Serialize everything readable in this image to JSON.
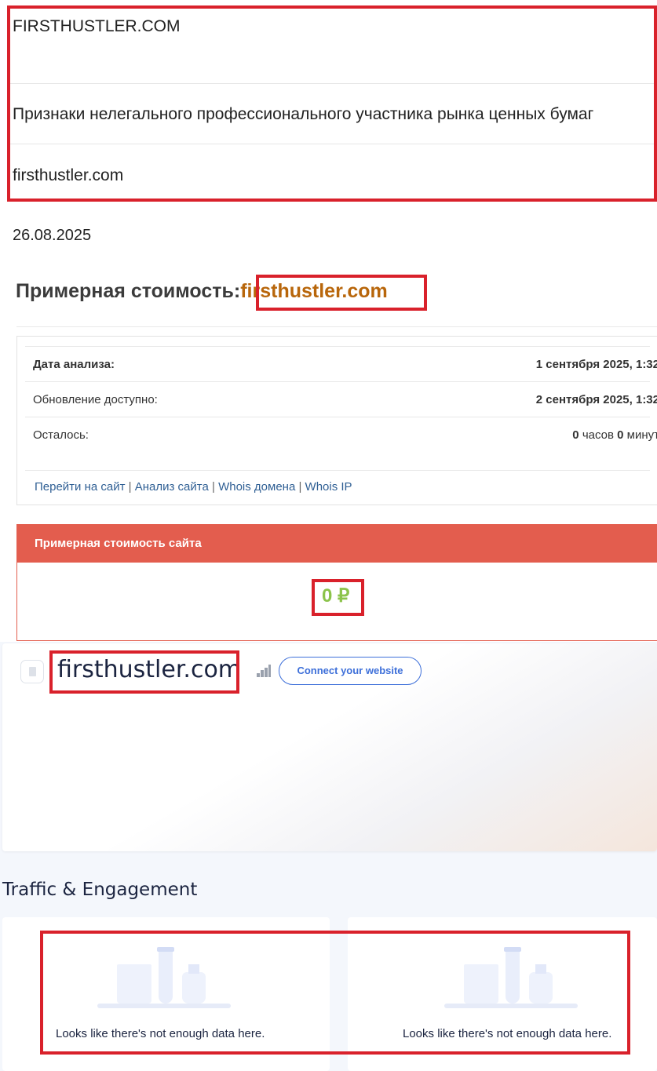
{
  "top_table": {
    "title": "FIRSTHUSTLER.COM",
    "description": "Признаки нелегального профессионального участника рынка ценных бумаг",
    "url": "firsthustler.com"
  },
  "date": "26.08.2025",
  "cost_heading": {
    "label": "Примерная стоимость:",
    "domain": "firsthustler.com"
  },
  "analysis": {
    "rows": [
      {
        "label": "Дата анализа:",
        "value": "1 сентября 2025, 1:32"
      },
      {
        "label": "Обновление доступно:",
        "value": "2 сентября 2025, 1:32"
      },
      {
        "label": "Осталось:",
        "hours": "0",
        "hours_unit": "часов",
        "minutes": "0",
        "minutes_unit": "минут"
      }
    ],
    "links": [
      "Перейти на сайт",
      "Анализ сайта",
      "Whois домена",
      "Whois IP"
    ],
    "separator": "|"
  },
  "estimate": {
    "header": "Примерная стоимость сайта",
    "value": "0 ₽"
  },
  "similarweb": {
    "domain": "firsthustler.com",
    "connect_button": "Connect your website",
    "section_title": "Traffic & Engagement",
    "empty_messages": [
      "Looks like there's not enough data here.",
      "Looks like there's not enough data here."
    ]
  },
  "colors": {
    "highlight_border": "#d9212b",
    "estimate_header_bg": "#e35d4e",
    "estimate_value": "#8bc34a",
    "domain_accent": "#b8660b",
    "link": "#2f5f94",
    "connect_button": "#3d6fd9"
  }
}
